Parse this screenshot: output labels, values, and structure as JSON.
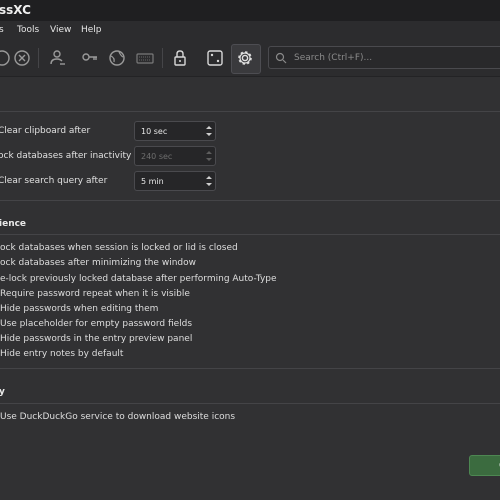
{
  "window": {
    "title": "ssXC"
  },
  "menu": {
    "items": [
      "s",
      "Tools",
      "View",
      "Help"
    ]
  },
  "toolbar": {
    "icons": [
      "lock-circle-icon",
      "close-circle-icon",
      "user-edit-icon",
      "key-icon",
      "globe-icon",
      "keyboard-icon",
      "padlock-icon",
      "dice-icon",
      "gear-icon"
    ],
    "active": "gear-icon"
  },
  "search": {
    "placeholder": "Search (Ctrl+F)..."
  },
  "timeouts": {
    "clear_clipboard_label": "Clear clipboard after",
    "clear_clipboard_value": "10 sec",
    "lock_db_label": "ock databases after inactivity of",
    "lock_db_value": "240 sec",
    "clear_search_label": "Clear search query after",
    "clear_search_value": "5 min"
  },
  "convenience": {
    "title": "ience",
    "options": [
      "ock databases when session is locked or lid is closed",
      "ock databases after minimizing the window",
      "e-lock previously locked database after performing Auto-Type",
      "Require password repeat when it is visible",
      "Hide passwords when editing them",
      "Use placeholder for empty password fields",
      "Hide passwords in the entry preview panel",
      "Hide entry notes by default"
    ]
  },
  "privacy": {
    "title": "y",
    "option": "Use DuckDuckGo service to download website icons"
  },
  "footer": {
    "ok_label": "O"
  },
  "colors": {
    "accent_ok": "#3b6b3f",
    "background": "#313133"
  }
}
